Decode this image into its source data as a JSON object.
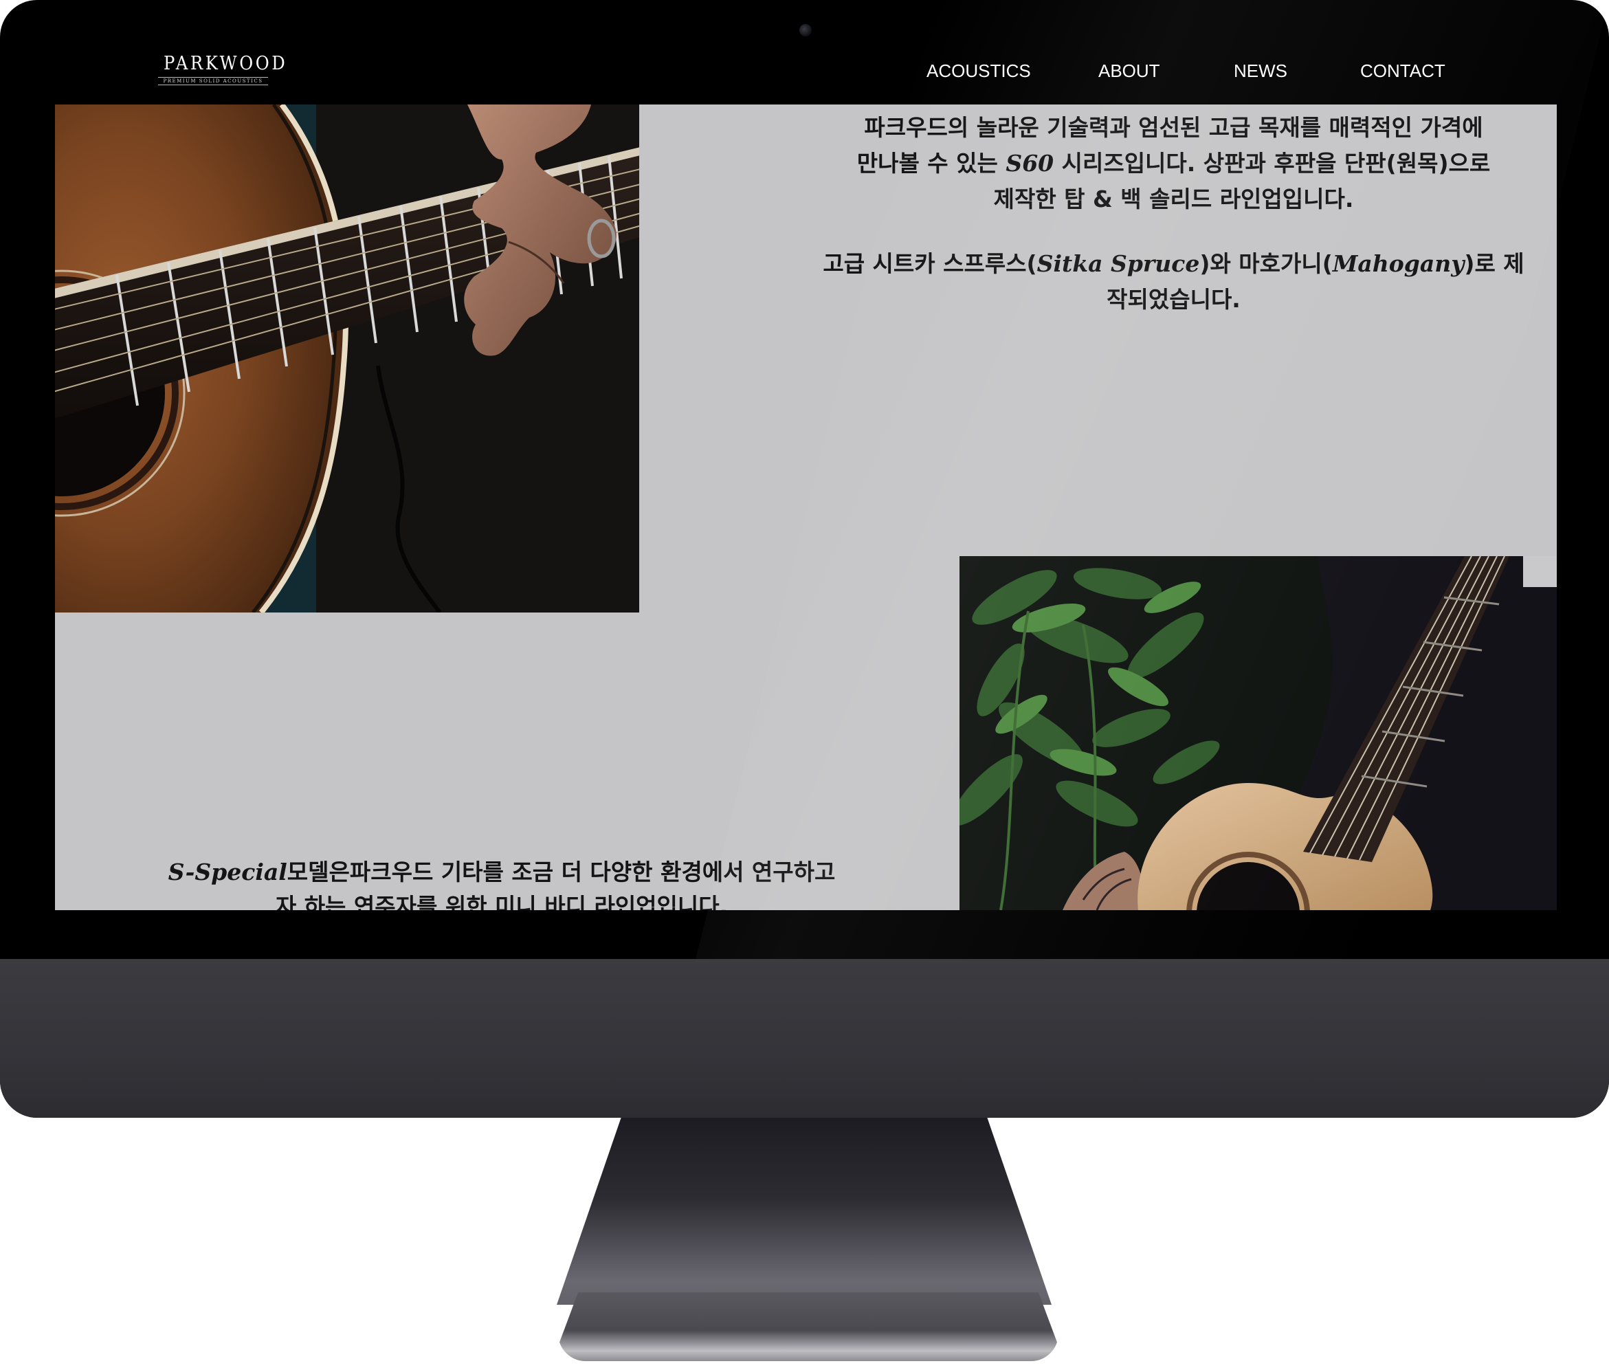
{
  "brand": {
    "name": "PARKWOOD",
    "tagline": "PREMIUM SOLID ACOUSTICS"
  },
  "nav": {
    "items": [
      {
        "label": "ACOUSTICS"
      },
      {
        "label": "ABOUT"
      },
      {
        "label": "NEWS"
      },
      {
        "label": "CONTACT"
      }
    ]
  },
  "content": {
    "intro": {
      "line1": "파크우드의 놀라운 기술력과 엄선된 고급 목재를 매력적인 가격에",
      "line2_pre": "만나볼 수 있는 ",
      "line2_series": "S60",
      "line2_post": " 시리즈입니다. 상판과 후판을 단판(원목)으로",
      "line3": "제작한 탑 & 백 솔리드 라인업입니다."
    },
    "materials": {
      "pre": "고급 시트카 스프루스(",
      "wood1": "Sitka Spruce",
      "mid": ")와 마호가니(",
      "wood2": "Mahogany",
      "post": ")로 제",
      "line2": "작되었습니다."
    },
    "special": {
      "model": "S-Special",
      "line1_post": "모델은파크우드 기타를 조금 더 다양한 환경에서 연구하고",
      "line2": "자 하는 연주자를 위한 미니 바디 라인업입니다."
    }
  },
  "colors": {
    "page_background": "#c5c5c7",
    "header_background": "#000000",
    "text": "#141414",
    "nav_text": "#ffffff"
  },
  "icons": {
    "camera": "webcam-dot"
  }
}
